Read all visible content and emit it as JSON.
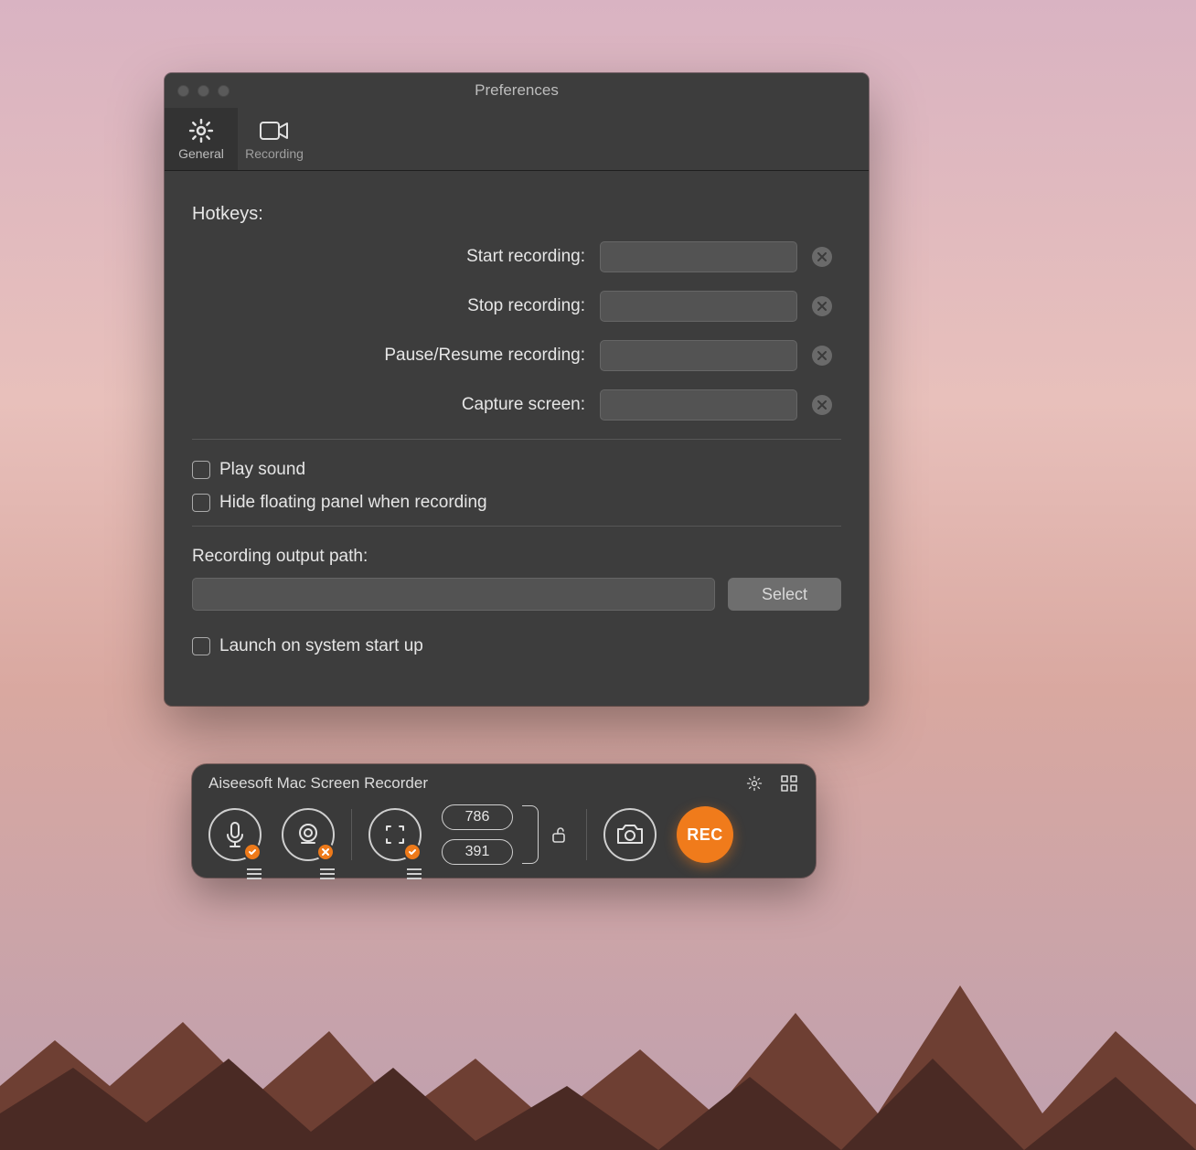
{
  "prefs": {
    "window_title": "Preferences",
    "tabs": {
      "general": "General",
      "recording": "Recording"
    },
    "hotkeys_heading": "Hotkeys:",
    "hotkeys": {
      "start_label": "Start recording:",
      "start_value": "",
      "stop_label": "Stop recording:",
      "stop_value": "",
      "pause_label": "Pause/Resume recording:",
      "pause_value": "",
      "capture_label": "Capture screen:",
      "capture_value": ""
    },
    "play_sound_label": "Play sound",
    "hide_panel_label": "Hide floating panel when recording",
    "output_path_label": "Recording output path:",
    "output_path_value": "",
    "select_button": "Select",
    "launch_startup_label": "Launch on system start up"
  },
  "panel": {
    "title": "Aiseesoft Mac Screen Recorder",
    "dimensions": {
      "width": "786",
      "height": "391"
    },
    "rec_label": "REC"
  },
  "colors": {
    "accent": "#f07b1b",
    "window_bg": "#3d3d3d"
  }
}
